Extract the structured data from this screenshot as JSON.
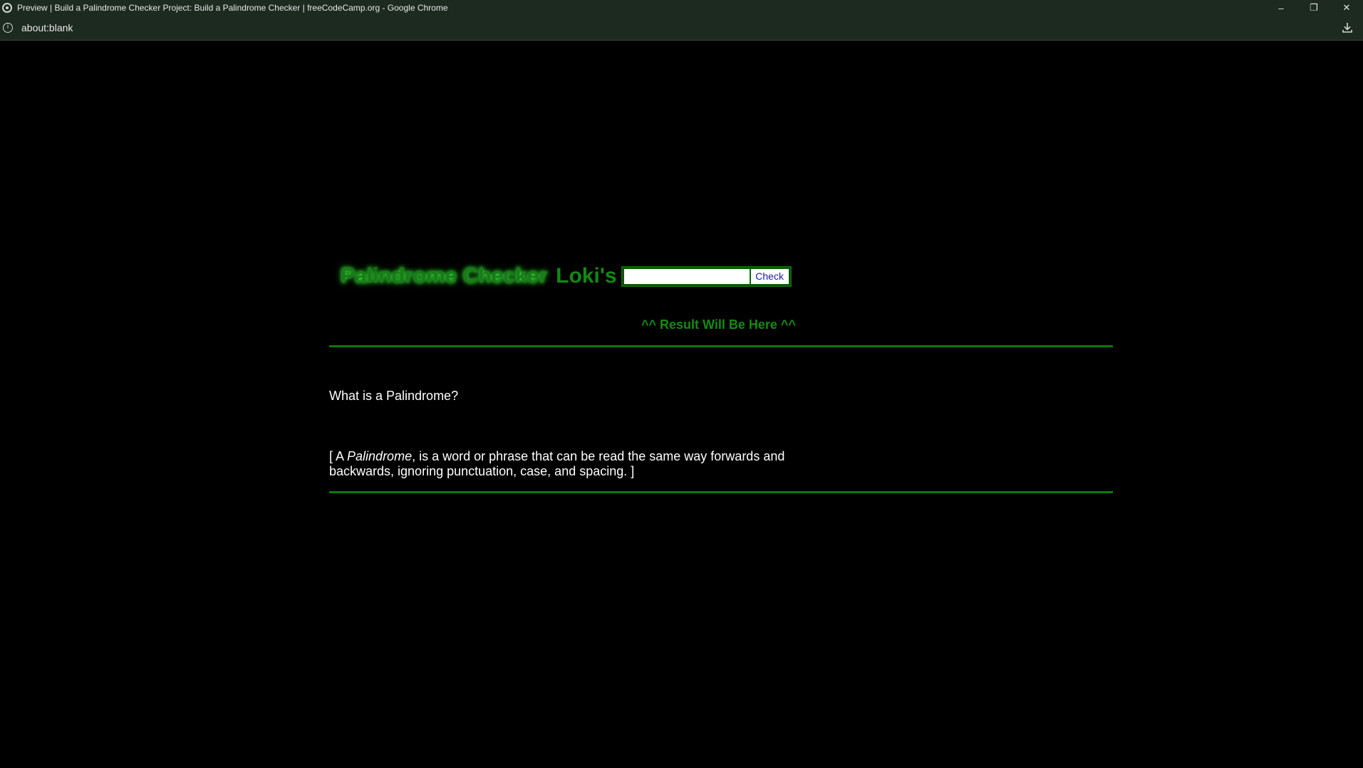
{
  "browser": {
    "window_title": "Preview | Build a Palindrome Checker Project: Build a Palindrome Checker | freeCodeCamp.org - Google Chrome",
    "url": "about:blank",
    "controls": {
      "minimize": "–",
      "restore": "❐",
      "close": "✕"
    },
    "info_icon_glyph": "i"
  },
  "page": {
    "title": "Palindrome Checker",
    "owner": "Loki's",
    "input_value": "",
    "input_placeholder": "",
    "check_button": "Check",
    "result_text": "^^ Result Will Be Here ^^",
    "question": "What is a Palindrome?",
    "definition": {
      "open": "[ A ",
      "term": "Palindrome",
      "rest": ", is a word or phrase that can be read the same way forwards and backwards, ignoring punctuation, case, and spacing. ]"
    }
  },
  "colors": {
    "background": "#000000",
    "accent_green": "#0b7a0b",
    "chrome_bar": "#1d2a1f"
  }
}
